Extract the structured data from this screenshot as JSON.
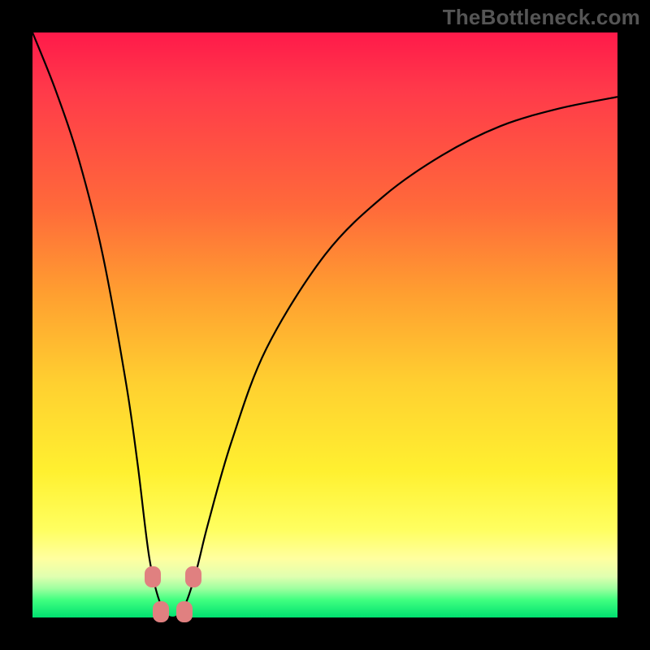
{
  "watermark": "TheBottleneck.com",
  "colors": {
    "frame": "#000000",
    "curve": "#000000",
    "marker": "#e08080"
  },
  "chart_data": {
    "type": "line",
    "title": "",
    "xlabel": "",
    "ylabel": "",
    "xlim": [
      0,
      100
    ],
    "ylim": [
      0,
      100
    ],
    "note": "x and y read off the plot area (0-100 each, y=0 at bottom / green, y=100 at top / red). Curve is a V-shaped dip to ~0 around x≈24, rising asymptotically toward the right.",
    "series": [
      {
        "name": "bottleneck-curve",
        "x": [
          0,
          4,
          8,
          12,
          16,
          18,
          20,
          22,
          24,
          26,
          28,
          30,
          34,
          40,
          50,
          60,
          70,
          80,
          90,
          100
        ],
        "values": [
          100,
          90,
          78,
          62,
          40,
          26,
          10,
          2,
          0,
          2,
          8,
          16,
          30,
          46,
          62,
          72,
          79,
          84,
          87,
          89
        ]
      }
    ],
    "markers": [
      {
        "x": 20.5,
        "y": 7
      },
      {
        "x": 22,
        "y": 1
      },
      {
        "x": 26,
        "y": 1
      },
      {
        "x": 27.5,
        "y": 7
      }
    ],
    "gradient_stops": [
      {
        "pct": 0,
        "color": "#ff1a4a"
      },
      {
        "pct": 10,
        "color": "#ff3a4a"
      },
      {
        "pct": 30,
        "color": "#ff6a3a"
      },
      {
        "pct": 45,
        "color": "#ffa030"
      },
      {
        "pct": 60,
        "color": "#ffd030"
      },
      {
        "pct": 75,
        "color": "#fff030"
      },
      {
        "pct": 85,
        "color": "#ffff60"
      },
      {
        "pct": 90,
        "color": "#ffffa0"
      },
      {
        "pct": 93,
        "color": "#e0ffb0"
      },
      {
        "pct": 95,
        "color": "#a0ffa0"
      },
      {
        "pct": 97,
        "color": "#40ff80"
      },
      {
        "pct": 100,
        "color": "#00e070"
      }
    ]
  }
}
